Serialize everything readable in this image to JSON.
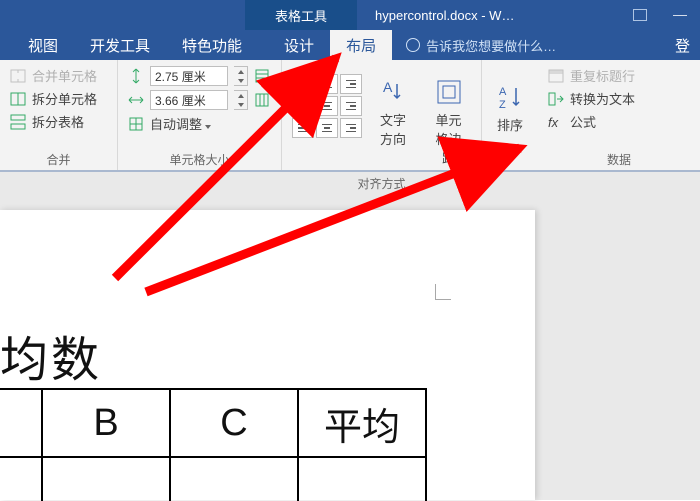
{
  "titlebar": {
    "context_tab": "表格工具",
    "doc_title": "hypercontrol.docx - W…"
  },
  "tabs": {
    "view": "视图",
    "dev": "开发工具",
    "feature": "特色功能",
    "design": "设计",
    "layout": "布局"
  },
  "tell_me": "告诉我您想要做什么…",
  "account": "登",
  "ribbon": {
    "merge": {
      "merge_cells": "合并单元格",
      "split_cells": "拆分单元格",
      "split_table": "拆分表格",
      "group": "合并"
    },
    "size": {
      "height": "2.75 厘米",
      "width": "3.66 厘米",
      "autofit": "自动调整",
      "group": "单元格大小"
    },
    "align": {
      "dir": "文字方向",
      "margin": "单元格边距",
      "group": "对齐方式"
    },
    "sort": "排序",
    "data": {
      "repeat_header": "重复标题行",
      "to_text": "转换为文本",
      "formula": "公式",
      "group": "数据"
    }
  },
  "doc": {
    "heading": "均数",
    "headers": [
      "B",
      "C",
      "平均"
    ]
  }
}
